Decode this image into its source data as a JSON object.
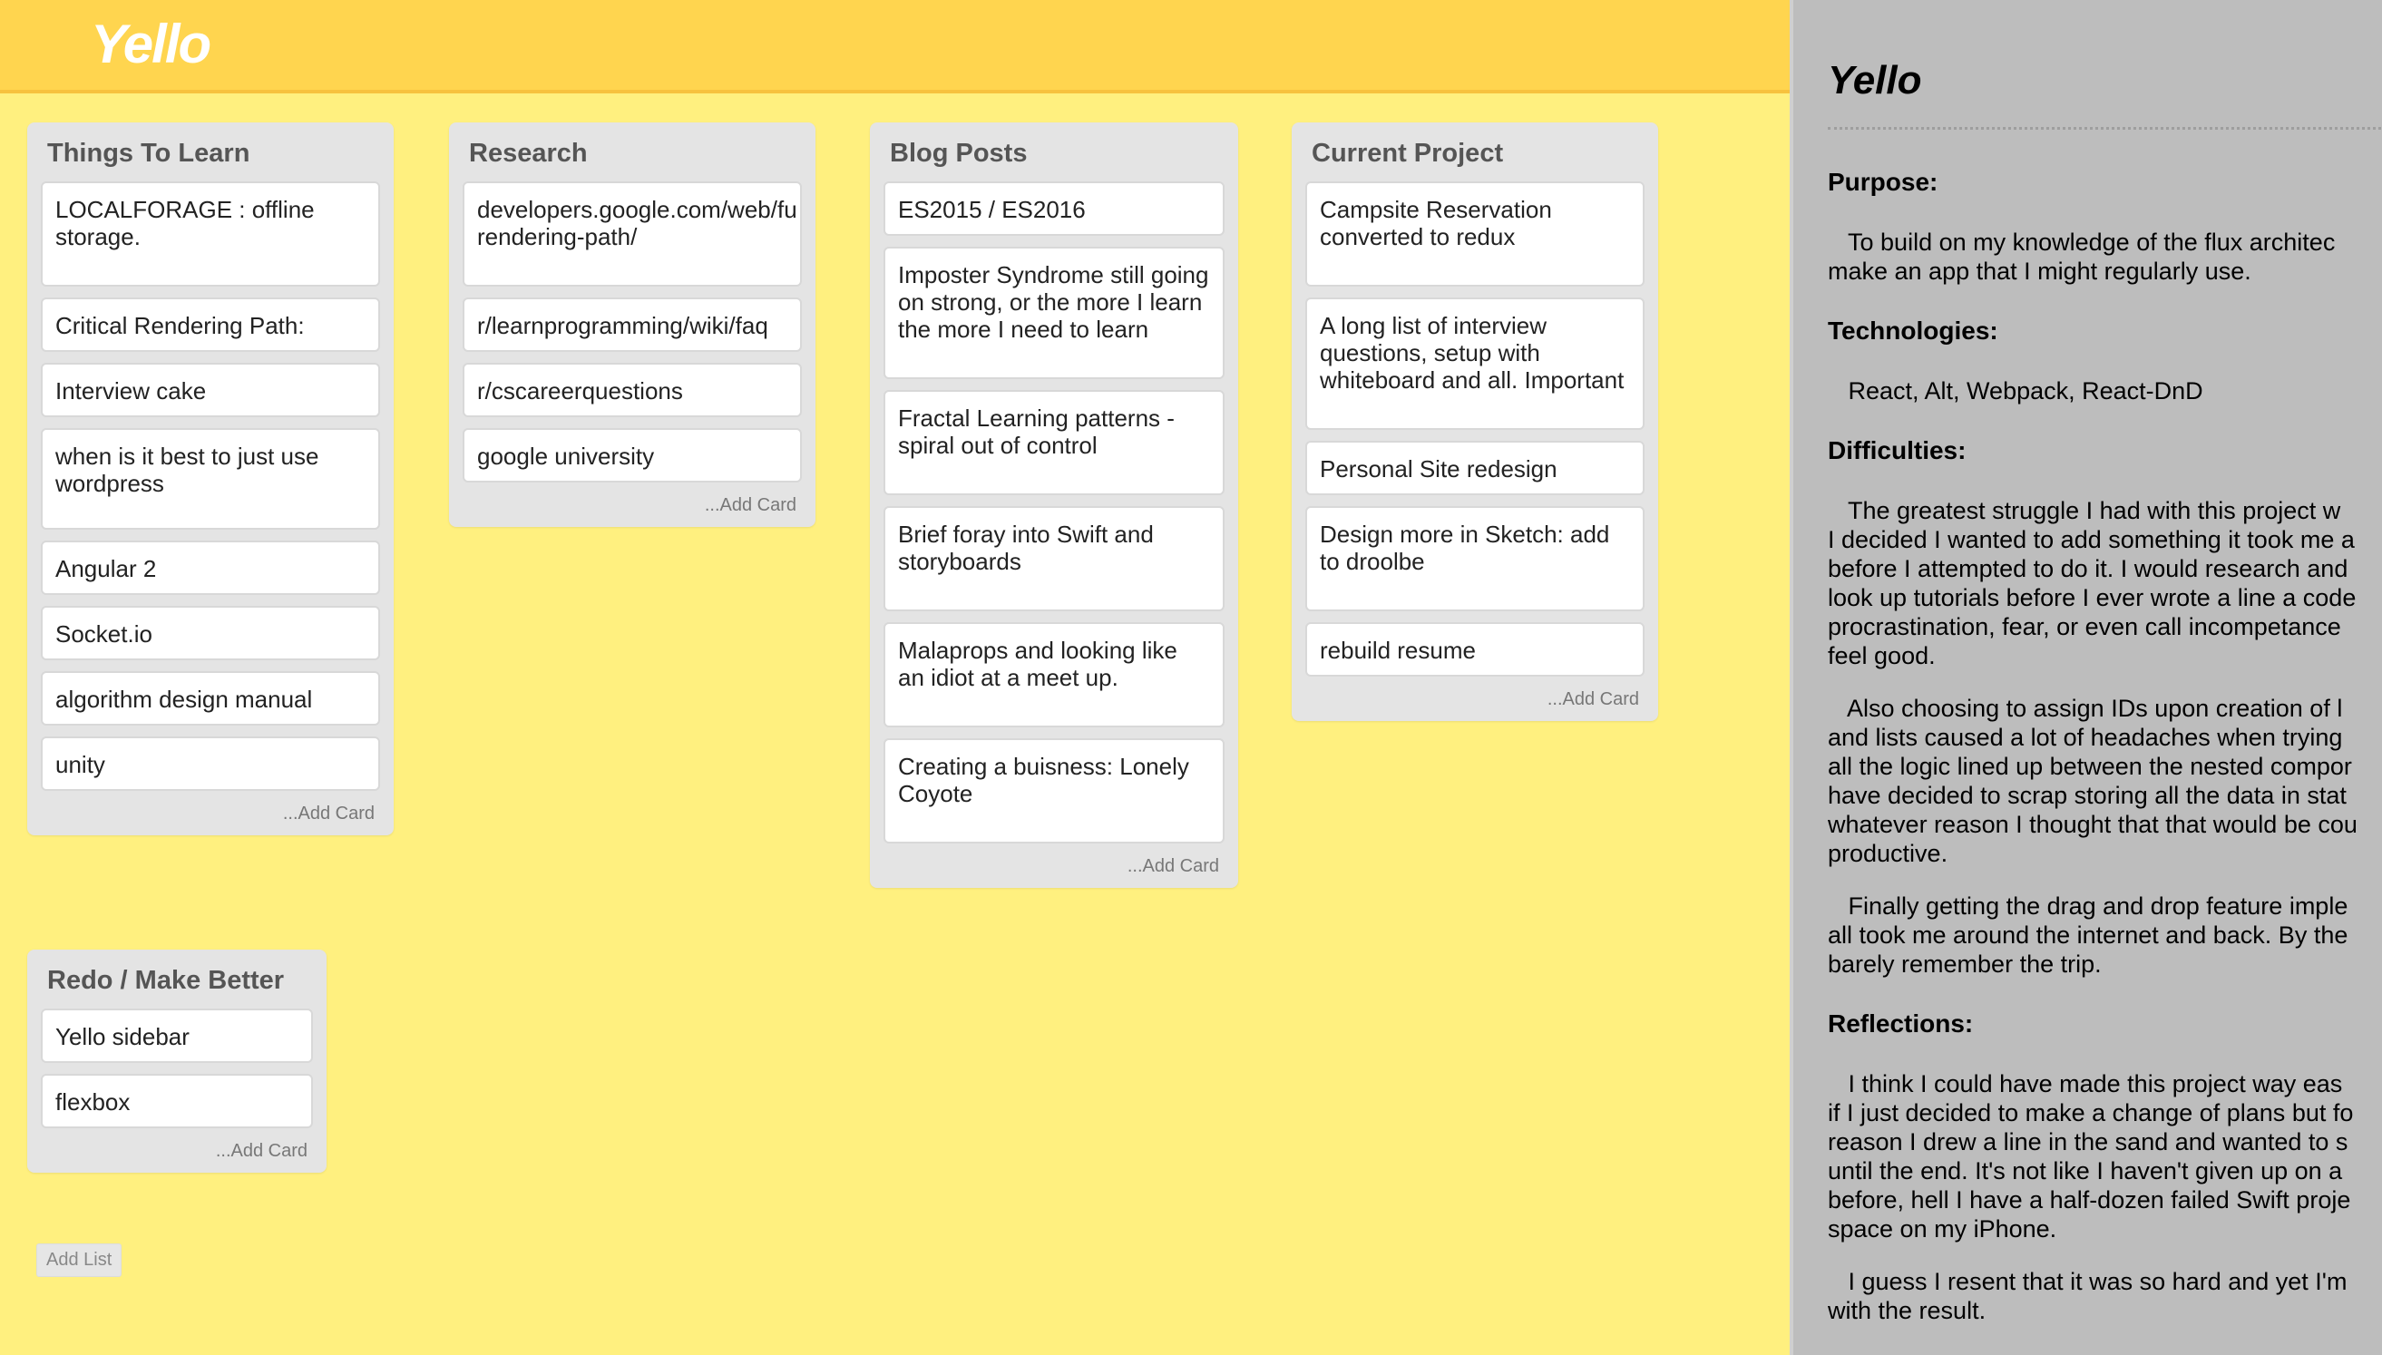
{
  "header": {
    "logo": "Yello"
  },
  "lists": [
    {
      "title": "Things To Learn",
      "cards": [
        "LOCALFORAGE : offline\nstorage.",
        "Critical Rendering Path:",
        "Interview cake",
        "when is it best to just use\nwordpress",
        "Angular 2",
        "Socket.io",
        "algorithm design manual",
        "unity"
      ],
      "add_card": "...Add Card"
    },
    {
      "title": "Research",
      "cards": [
        "developers.google.com/web/fu\nrendering-path/",
        "r/learnprogramming/wiki/faq",
        "r/cscareerquestions",
        "google university"
      ],
      "add_card": "...Add Card"
    },
    {
      "title": "Blog Posts",
      "cards": [
        "ES2015 / ES2016",
        "Imposter Syndrome still going\non strong, or the more I learn\nthe more I need to learn",
        "Fractal Learning patterns -\nspiral out of control",
        "Brief foray into Swift and\nstoryboards",
        "Malaprops and looking like\nan idiot at a meet up.",
        "Creating a buisness: Lonely\nCoyote"
      ],
      "add_card": "...Add Card"
    },
    {
      "title": "Current Project",
      "cards": [
        "Campsite Reservation\nconverted to redux",
        "A long list of interview\nquestions, setup with\nwhiteboard and all. Important",
        "Personal Site redesign",
        "Design more in Sketch: add\nto droolbe",
        "rebuild resume"
      ],
      "add_card": "...Add Card"
    },
    {
      "title": "Redo / Make Better",
      "cards": [
        "Yello sidebar",
        "flexbox"
      ],
      "add_card": "...Add Card"
    }
  ],
  "add_list": "Add List",
  "sidebar": {
    "title": "Yello",
    "purpose_heading": "Purpose:",
    "purpose_text": "   To build on my knowledge of the flux architec\nmake an app that I might regularly use.",
    "technologies_heading": "Technologies:",
    "technologies_text": "   React, Alt, Webpack, React-DnD",
    "difficulties_heading": "Difficulties:",
    "difficulties_p1": "   The greatest struggle I had with this project w\nI decided I wanted to add something it took me a\nbefore I attempted to do it. I would research and\nlook up tutorials before I ever wrote a line a code\nprocrastination, fear, or even call incompetance \nfeel good.",
    "difficulties_p2": "   Also choosing to assign IDs upon creation of l\nand lists caused a lot of headaches when trying \nall the logic lined up between the nested compor\nhave decided to scrap storing all the data in stat\nwhatever reason I thought that that would be cou\nproductive.",
    "difficulties_p3": "   Finally getting the drag and drop feature imple\nall took me around the internet and back. By the\nbarely remember the trip.",
    "reflections_heading": "Reflections:",
    "reflections_p1": "   I think I could have made this project way eas\nif I just decided to make a change of plans but fo\nreason I drew a line in the sand and wanted to s\nuntil the end. It's not like I haven't given up on a\nbefore, hell I have a half-dozen failed Swift proje\nspace on my iPhone.",
    "reflections_p2": "   I guess I resent that it was so hard and yet I'm\nwith the result."
  }
}
